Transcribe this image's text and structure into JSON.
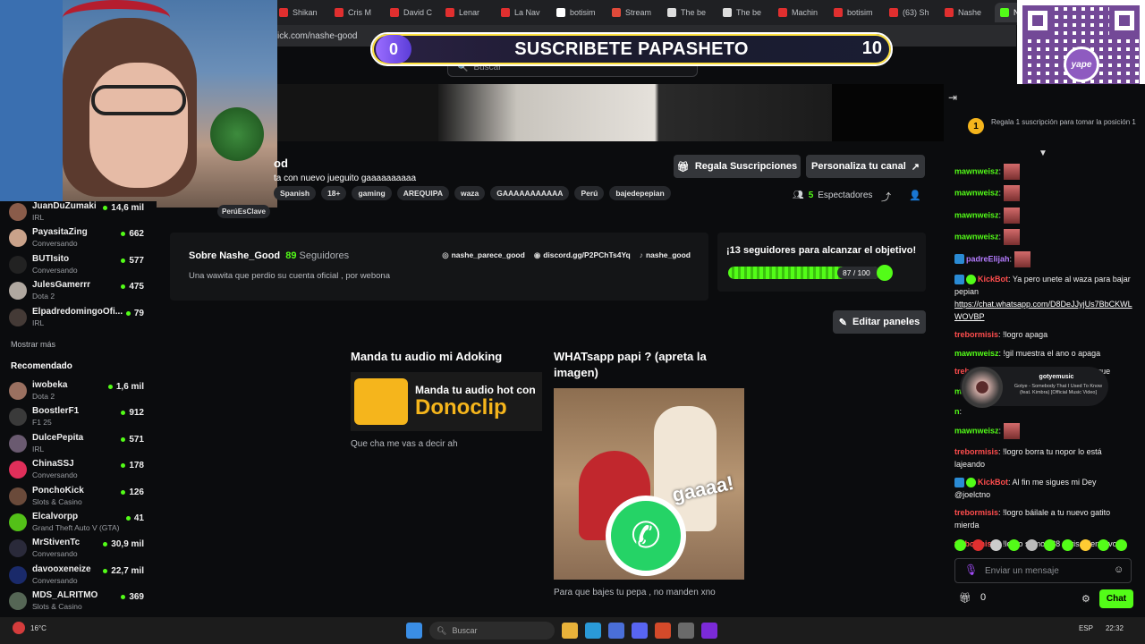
{
  "browser": {
    "tabs": [
      {
        "label": "Shikan",
        "color": "#e02f2f"
      },
      {
        "label": "Cris M",
        "color": "#e02f2f"
      },
      {
        "label": "David C",
        "color": "#e02f2f"
      },
      {
        "label": "Lenar",
        "color": "#e02f2f"
      },
      {
        "label": "La Nav",
        "color": "#e02f2f"
      },
      {
        "label": "botisim",
        "color": "#ffffff"
      },
      {
        "label": "Stream",
        "color": "#e04a3a"
      },
      {
        "label": "The be",
        "color": "#dddddd"
      },
      {
        "label": "The be",
        "color": "#dddddd"
      },
      {
        "label": "Machin",
        "color": "#e02f2f"
      },
      {
        "label": "botisim",
        "color": "#e02f2f"
      },
      {
        "label": "(63) Sh",
        "color": "#e02f2f"
      },
      {
        "label": "Nashe",
        "color": "#e02f2f"
      },
      {
        "label": "Na",
        "color": "#53fc18",
        "active": true
      }
    ],
    "url": "ick.com/nashe-good",
    "close_glyph": "✕"
  },
  "overlay": {
    "sub_current": "0",
    "sub_text": "SUSCRIBETE PAPASHETO",
    "sub_goal": "10",
    "qr_logo": "yape"
  },
  "header": {
    "search_placeholder": "Buscar",
    "search_icon": "🔍"
  },
  "sidebar": {
    "channels": [
      {
        "name": "JuanDuZumaki",
        "category": "IRL",
        "viewers": "14,6 mil",
        "color": "#8a5c4a"
      },
      {
        "name": "PayasitaZing",
        "category": "Conversando",
        "viewers": "662",
        "color": "#c9a28a"
      },
      {
        "name": "BUTIsito",
        "category": "Conversando",
        "viewers": "577",
        "color": "#222222"
      },
      {
        "name": "JulesGamerrr",
        "category": "Dota 2",
        "viewers": "475",
        "color": "#b0a8a0"
      },
      {
        "name": "ElpadredomingoOfi...",
        "category": "IRL",
        "viewers": "79",
        "color": "#443a36"
      }
    ],
    "show_more": "Mostrar más",
    "recommended_title": "Recomendado",
    "recommended": [
      {
        "name": "iwobeka",
        "category": "Dota 2",
        "viewers": "1,6 mil",
        "color": "#9a7060"
      },
      {
        "name": "BoostlerF1",
        "category": "F1 25",
        "viewers": "912",
        "color": "#3a3a3a"
      },
      {
        "name": "DulcePepita",
        "category": "IRL",
        "viewers": "571",
        "color": "#6a5a70"
      },
      {
        "name": "ChinaSSJ",
        "category": "Conversando",
        "viewers": "178",
        "color": "#e02f5a"
      },
      {
        "name": "PonchoKick",
        "category": "Slots & Casino",
        "viewers": "126",
        "color": "#6a4a3a"
      },
      {
        "name": "Elcalvorpp",
        "category": "Grand Theft Auto V (GTA)",
        "viewers": "41",
        "color": "#53c018"
      },
      {
        "name": "MrStivenTc",
        "category": "Conversando",
        "viewers": "30,9 mil",
        "color": "#2a2a3a"
      },
      {
        "name": "davooxeneize",
        "category": "Conversando",
        "viewers": "22,7 mil",
        "color": "#1a2a6a"
      },
      {
        "name": "MDS_ALRITMO",
        "category": "Slots & Casino",
        "viewers": "369",
        "color": "#556655"
      }
    ]
  },
  "stream": {
    "title": "od",
    "subtitle": "ta con nuevo jueguito gaaaaaaaaaa",
    "tags": [
      "Spanish",
      "18+",
      "gaming",
      "AREQUIPA",
      "waza",
      "GAAAAAAAAAAA",
      "Perú",
      "bajedepepian"
    ],
    "extra_tag": "PerúEsClave",
    "gift_button": "Regala Suscripciones",
    "customize_button": "Personaliza tu canal",
    "viewers_count": "5",
    "viewers_label": "Espectadores",
    "share_icon": "⤴",
    "user_icon": "👤"
  },
  "about": {
    "title": "Sobre Nashe_Good",
    "followers": "89",
    "followers_label": "Seguidores",
    "description": "Una wawita que perdio su cuenta oficial , por webona",
    "socials": [
      {
        "icon": "◎",
        "label": "nashe_parece_good"
      },
      {
        "icon": "◉",
        "label": "discord.gg/P2PChTs4Yq"
      },
      {
        "icon": "♪",
        "label": "nashe_good"
      }
    ]
  },
  "goal": {
    "text": "¡13 seguidores para alcanzar el objetivo!",
    "count": "87 / 100",
    "progress": 0.87
  },
  "edit_panels": "Editar paneles",
  "panels": [
    {
      "title": "Manda tu audio mi Adoking",
      "img_line1": "Manda tu audio hot con",
      "img_line2": "Donoclip",
      "desc": "Que cha me vas a decir ah"
    },
    {
      "title": "WHATsapp papi ? (apreta la imagen)",
      "img_text": "gaaaa!",
      "desc": "Para que bajes tu pepa , no manden xno"
    }
  ],
  "chat": {
    "pinned_rank": "1",
    "pinned_text": "Regala 1 suscripción para tomar la posición 1",
    "messages": [
      {
        "user": "mawnweisz",
        "color": "#53fc18",
        "text": "",
        "emote": true
      },
      {
        "user": "mawnweisz",
        "color": "#53fc18",
        "text": "",
        "emote": true
      },
      {
        "user": "mawnweisz",
        "color": "#53fc18",
        "text": "",
        "emote": true
      },
      {
        "user": "mawnweisz",
        "color": "#53fc18",
        "text": "",
        "emote": true
      },
      {
        "user": "padreElijah",
        "color": "#b57cff",
        "text": "",
        "emote": true,
        "badge": true
      },
      {
        "user": "KickBot",
        "color": "#ff4d4d",
        "text": "Ya pero unete al waza para bajar pepian",
        "badges2": true,
        "link": "https://chat.whatsapp.com/D8DeJJyjUs7BbCKWLWOVBP"
      },
      {
        "user": "trebormisis",
        "color": "#ff4d4d",
        "text": "!logro apaga"
      },
      {
        "user": "mawnweisz",
        "color": "#53fc18",
        "text": "!gil muestra el ano o apaga"
      },
      {
        "user": "trebormisis",
        "color": "#ff4d4d",
        "text": "!logro estás preñada o porque"
      },
      {
        "user": "m",
        "color": "#53fc18",
        "text": "",
        "emote": true
      },
      {
        "user": "n",
        "color": "#53fc18",
        "text": ""
      },
      {
        "user": "mawnweisz",
        "color": "#53fc18",
        "text": "",
        "emote": true
      },
      {
        "user": "trebormisis",
        "color": "#ff4d4d",
        "text": "!logro borra tu nopor lo está lajeando"
      },
      {
        "user": "KickBot",
        "color": "#ff4d4d",
        "text": "Al fin me sigues mi Dey @joelctno",
        "badges2": true
      },
      {
        "user": "trebormisis",
        "color": "#ff4d4d",
        "text": "!logro báilale a tu nuevo gatito mierda"
      },
      {
        "user": "trebormisis",
        "color": "#ff4d4d",
        "text": "!logro somos 88 revisa denuevo"
      }
    ],
    "now_playing_title": "gotyemusic",
    "now_playing_song": "Gotye - Somebody That I Used To Know (feat. Kimbra) [Official Music Video]",
    "input_placeholder": "Enviar un mensaje",
    "gift_count": "0",
    "chat_button": "Chat"
  },
  "taskbar": {
    "temperature": "16°C",
    "search": "Buscar",
    "lang": "ESP",
    "time": "22:32"
  }
}
